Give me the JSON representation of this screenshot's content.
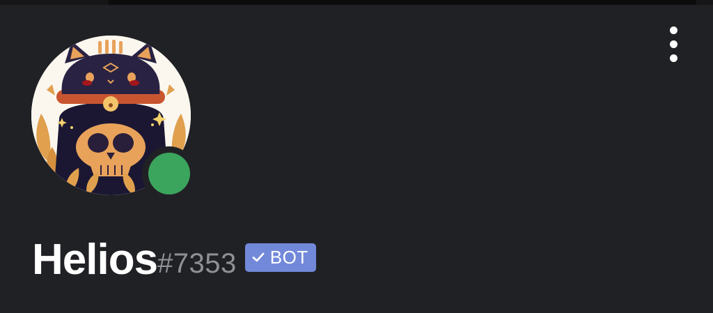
{
  "profile": {
    "username": "Helios",
    "discriminator": "#7353",
    "badge_label": "BOT",
    "status": "online"
  },
  "icons": {
    "menu": "more-vertical-icon",
    "badge": "checkmark-icon",
    "status": "online-status-icon"
  },
  "colors": {
    "background": "#202125",
    "status_online": "#3ba55d",
    "badge": "#7289da",
    "discriminator": "#8e9297"
  }
}
